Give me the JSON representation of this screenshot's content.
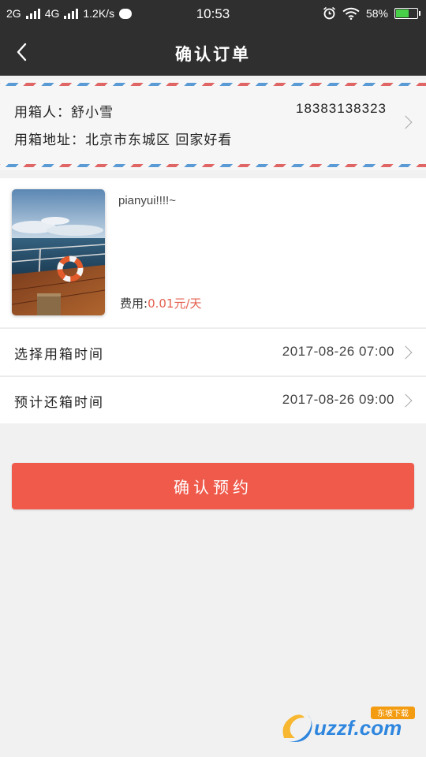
{
  "status_bar": {
    "network1": "2G",
    "network2": "4G",
    "speed": "1.2K/s",
    "time": "10:53",
    "battery_percent": "58%",
    "battery_level": 0.58,
    "icons": [
      "signal-icon",
      "chat-icon",
      "alarm-icon",
      "wifi-icon",
      "battery-icon"
    ]
  },
  "header": {
    "title": "确认订单"
  },
  "address": {
    "recipient_label": "用箱人：",
    "recipient_name": "舒小雪",
    "phone": "18383138323",
    "address_label": "用箱地址：",
    "address_value": "北京市东城区 回家好看"
  },
  "product": {
    "name": "pianyui!!!!~",
    "fee_label": "费用:",
    "fee_value": "0.01元/天"
  },
  "times": {
    "select_label": "选择用箱时间",
    "select_value": "2017-08-26 07:00",
    "return_label": "预计还箱时间",
    "return_value": "2017-08-26 09:00"
  },
  "actions": {
    "confirm_label": "确认预约"
  },
  "watermark": {
    "text": "uzzf.com",
    "badge": "东坡下载"
  },
  "colors": {
    "header_bg": "#2f2f2f",
    "accent": "#ef5a4b",
    "fee_color": "#e4604f"
  }
}
